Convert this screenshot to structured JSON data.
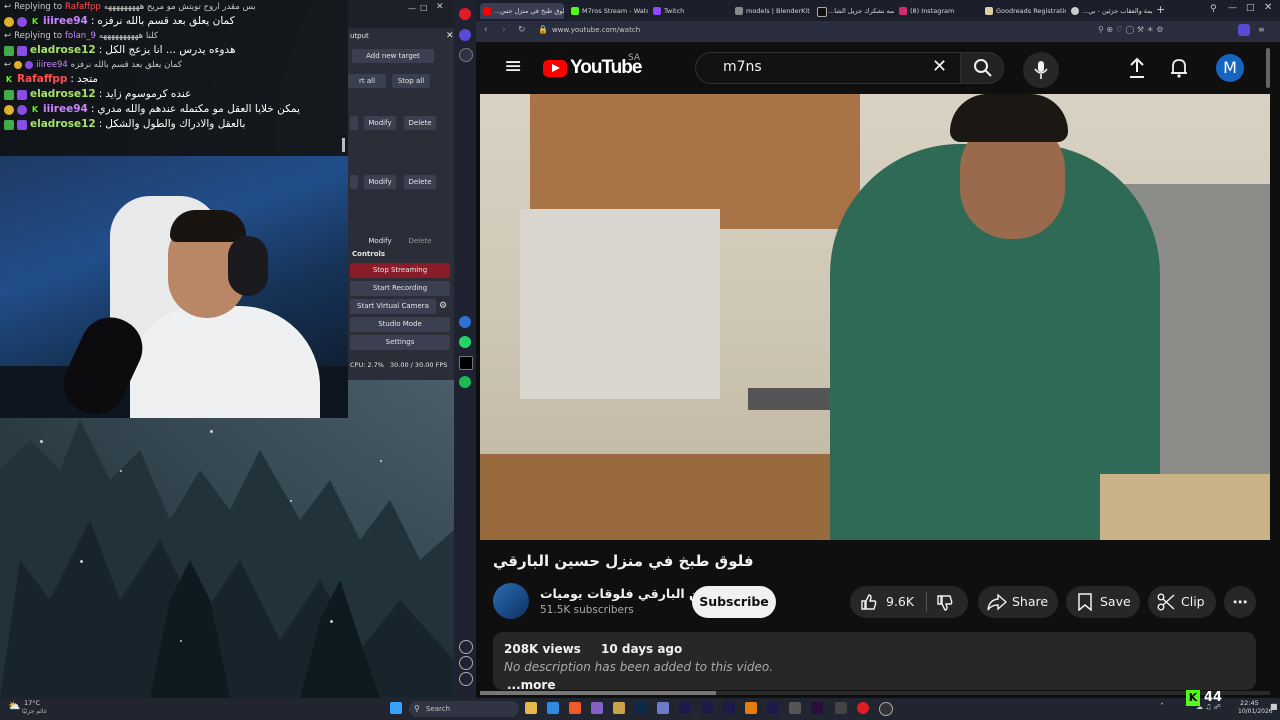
{
  "chat": {
    "lines": [
      {
        "type": "reply",
        "prefix": "Replying to",
        "user": "Rafaffpp",
        "text": "بس مقدر اروح تويتش مو مريح هههههههههه"
      },
      {
        "type": "msg",
        "user": "iiiree94",
        "text": "كمان يعلق بعد قسم بالله نرفزه"
      },
      {
        "type": "reply",
        "prefix": "Replying to",
        "user": "folan_9",
        "text": "كلنا ههههههههههه"
      },
      {
        "type": "msg",
        "user": "eladrose12",
        "text": "هدوءه يدرس ... انا يزعج الكل"
      },
      {
        "type": "reply",
        "prefix": "Replying to",
        "user": "iiiree94",
        "text": "كمان يعلق بعد قسم بالله نرفزه"
      },
      {
        "type": "msg",
        "user": "Rafaffpp",
        "text": "متجد"
      },
      {
        "type": "msg",
        "user": "eladrose12",
        "text": "عنده كرموسوم زايد"
      },
      {
        "type": "msg",
        "user": "iiiree94",
        "text": "يمكن خلايا العقل مو مكتمله عندهم والله مدري"
      },
      {
        "type": "msg",
        "user": "eladrose12",
        "text": "بالعقل والادراك والطول والشكل"
      }
    ]
  },
  "obs": {
    "output_label": "utput",
    "add_new_target": "Add new target",
    "start_all": "rt all",
    "stop_all": "Stop all",
    "modify": "Modify",
    "delete": "Delete",
    "controls_title": "Controls",
    "stop_streaming": "Stop Streaming",
    "start_recording": "Start Recording",
    "start_virtual_camera": "Start Virtual Camera",
    "studio_mode": "Studio Mode",
    "settings": "Settings",
    "cpu": "CPU: 2.7%",
    "fps": "30.00 / 30.00 FPS"
  },
  "browser": {
    "tabs": [
      {
        "label": "فلوق طبخ في منزل حس...",
        "active": true
      },
      {
        "label": "M7ros Stream - Watc..."
      },
      {
        "label": "Twitch"
      },
      {
        "label": "models | BlenderKit"
      },
      {
        "label": "يا حلوسه نشكرك جزيل الشا..."
      },
      {
        "label": "(8) Instagram"
      },
      {
        "label": "Goodreads Registration"
      },
      {
        "label": "الجريمة والعقاب جزئين - بي..."
      }
    ],
    "url": "www.youtube.com/watch"
  },
  "youtube": {
    "logo_text": "YouTube",
    "country": "SA",
    "search_value": "m7ns",
    "avatar_letter": "M",
    "video_title": "فلوق طبخ في منزل حسين البارقي",
    "channel_name": "حسين البارقي فلوقات يوميات",
    "subscribers": "51.5K subscribers",
    "subscribe_label": "Subscribe",
    "likes": "9.6K",
    "share_label": "Share",
    "save_label": "Save",
    "clip_label": "Clip",
    "views": "208K views",
    "date": "10 days ago",
    "description": "No description has been added to this video.",
    "more_label": "...more"
  },
  "taskbar": {
    "weather_temp": "17°C",
    "weather_text": "غائم جزئيًا",
    "search_placeholder": "Search",
    "kick_count": "44",
    "time": "22:45",
    "date": "10/01/2026"
  }
}
